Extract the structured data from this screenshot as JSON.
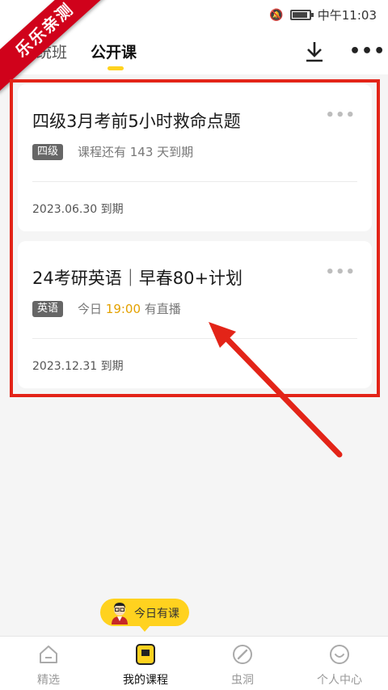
{
  "status_bar": {
    "time": "中午11:03"
  },
  "watermark": {
    "text": "乐乐亲测"
  },
  "top_nav": {
    "tabs": [
      {
        "label": "系统班",
        "active": false
      },
      {
        "label": "公开课",
        "active": true
      }
    ],
    "download_icon": "download-icon",
    "more_icon": "more-icon",
    "more_label": "•••"
  },
  "courses": [
    {
      "title": "四级3月考前5小时救命点题",
      "tag": "四级",
      "info": "课程还有 143 天到期",
      "expire": "2023.06.30 到期",
      "more": "•••"
    },
    {
      "title": "24考研英语｜早春80+计划",
      "tag": "英语",
      "info_prefix": "今日 ",
      "info_time": "19:00",
      "info_suffix": " 有直播",
      "expire": "2023.12.31 到期",
      "more": "•••"
    }
  ],
  "today_badge": {
    "label": "今日有课"
  },
  "bottom_nav": {
    "items": [
      {
        "label": "精选",
        "icon": "home-icon",
        "active": false
      },
      {
        "label": "我的课程",
        "icon": "course-book-icon",
        "active": true
      },
      {
        "label": "虫洞",
        "icon": "compass-icon",
        "active": false
      },
      {
        "label": "个人中心",
        "icon": "smile-icon",
        "active": false
      }
    ]
  },
  "colors": {
    "accent": "#ffd21f",
    "annotation_red": "#e32418",
    "live_time": "#e3a100"
  }
}
